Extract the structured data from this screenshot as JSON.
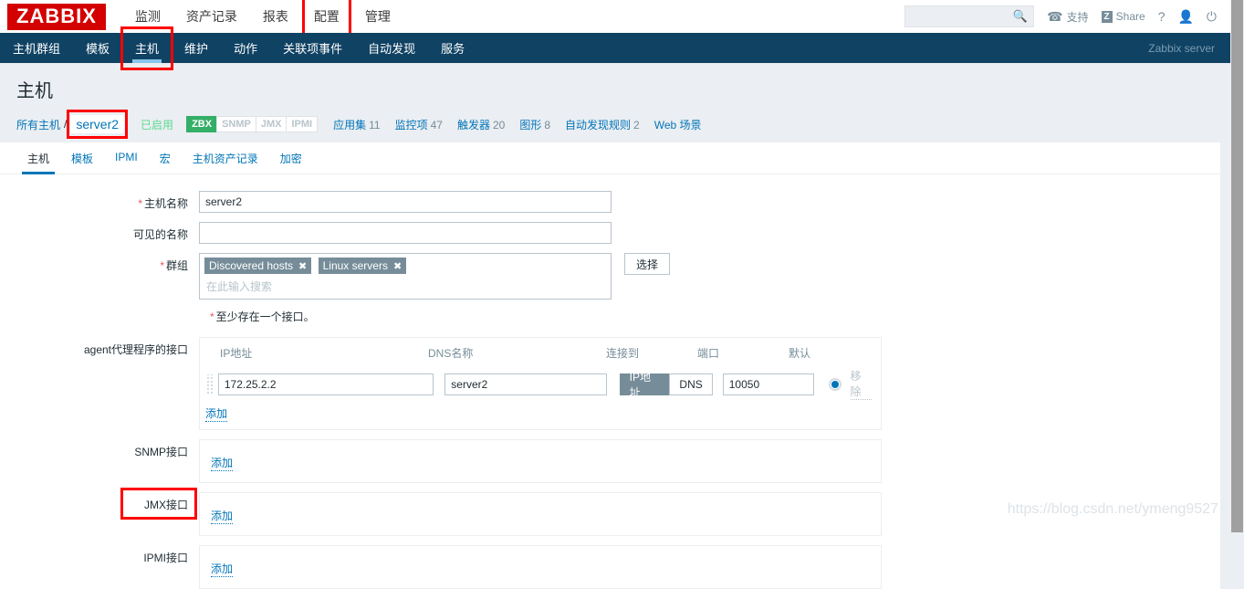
{
  "header": {
    "logo": "ZABBIX",
    "menu": [
      {
        "label": "监测"
      },
      {
        "label": "资产记录"
      },
      {
        "label": "报表"
      },
      {
        "label": "配置",
        "highlighted": true
      },
      {
        "label": "管理"
      }
    ],
    "search": {
      "value": "",
      "placeholder": "",
      "icon": "search-icon"
    },
    "support_label": "支持",
    "share_label": "Share",
    "share_badge": "Z",
    "help_label": "?",
    "user_icon": "user-icon",
    "power_icon": "power-icon",
    "headset_icon": "headset-icon"
  },
  "subnav": {
    "items": [
      {
        "label": "主机群组"
      },
      {
        "label": "模板"
      },
      {
        "label": "主机"
      },
      {
        "label": "维护"
      },
      {
        "label": "动作"
      },
      {
        "label": "关联项事件"
      },
      {
        "label": "自动发现"
      },
      {
        "label": "服务"
      }
    ],
    "server": "Zabbix server"
  },
  "page": {
    "title": "主机"
  },
  "breadcrumb": {
    "all_hosts": "所有主机",
    "separator": "/",
    "current": "server2",
    "status": "已启用",
    "badges": [
      {
        "label": "ZBX",
        "active": true
      },
      {
        "label": "SNMP",
        "active": false
      },
      {
        "label": "JMX",
        "active": false
      },
      {
        "label": "IPMI",
        "active": false
      }
    ],
    "links": [
      {
        "label": "应用集",
        "count": "11"
      },
      {
        "label": "监控项",
        "count": "47"
      },
      {
        "label": "触发器",
        "count": "20"
      },
      {
        "label": "图形",
        "count": "8"
      },
      {
        "label": "自动发现规则",
        "count": "2"
      },
      {
        "label": "Web 场景",
        "count": ""
      }
    ]
  },
  "tabs": [
    {
      "label": "主机",
      "active": true
    },
    {
      "label": "模板",
      "active": false
    },
    {
      "label": "IPMI",
      "active": false
    },
    {
      "label": "宏",
      "active": false
    },
    {
      "label": "主机资产记录",
      "active": false
    },
    {
      "label": "加密",
      "active": false
    }
  ],
  "form": {
    "host_name": {
      "label": "主机名称",
      "value": "server2",
      "required": true
    },
    "visible_name": {
      "label": "可见的名称",
      "value": "",
      "placeholder": "",
      "required": false
    },
    "groups": {
      "label": "群组",
      "required": true,
      "chips": [
        "Discovered hosts",
        "Linux servers"
      ],
      "placeholder": "在此输入搜索",
      "select_button": "选择"
    },
    "interface_note": "至少存在一个接口。",
    "agent_interface": {
      "label": "agent代理程序的接口",
      "columns": {
        "ip": "IP地址",
        "dns": "DNS名称",
        "connect_to": "连接到",
        "port": "端口",
        "default": "默认"
      },
      "row": {
        "ip": "172.25.2.2",
        "dns": "server2",
        "connect_ip": "IP地址",
        "connect_dns": "DNS",
        "connect_selected": "IP地址",
        "port": "10050",
        "remove": "移除",
        "is_default": true
      },
      "add": "添加"
    },
    "snmp_interface": {
      "label": "SNMP接口",
      "add": "添加"
    },
    "jmx_interface": {
      "label": "JMX接口",
      "add": "添加",
      "highlighted": true
    },
    "ipmi_interface": {
      "label": "IPMI接口",
      "add": "添加"
    }
  },
  "watermark": "https://blog.csdn.net/ymeng9527"
}
